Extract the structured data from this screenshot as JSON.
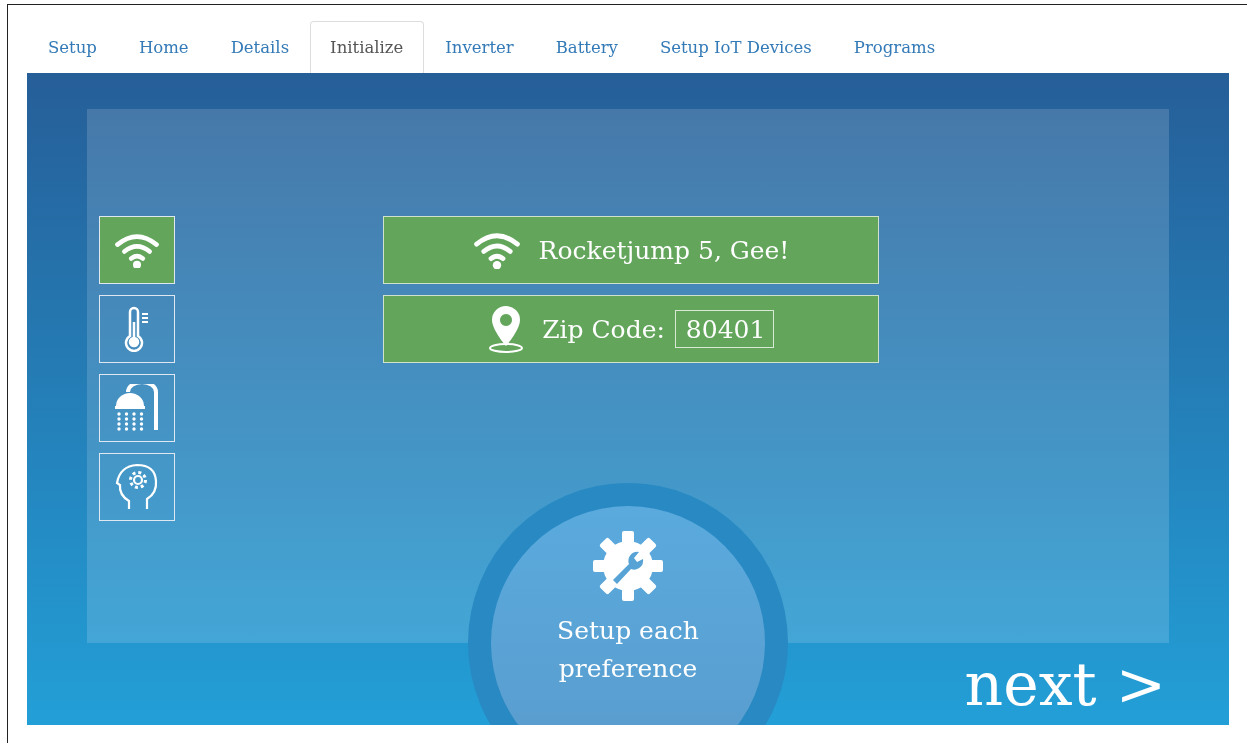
{
  "tabs": [
    {
      "label": "Setup",
      "selected": false
    },
    {
      "label": "Home",
      "selected": false
    },
    {
      "label": "Details",
      "selected": false
    },
    {
      "label": "Initialize",
      "selected": true
    },
    {
      "label": "Inverter",
      "selected": false
    },
    {
      "label": "Battery",
      "selected": false
    },
    {
      "label": "Setup IoT Devices",
      "selected": false
    },
    {
      "label": "Programs",
      "selected": false
    }
  ],
  "sidebar": {
    "items": [
      {
        "kind": "wifi",
        "selected": true
      },
      {
        "kind": "thermometer",
        "selected": false
      },
      {
        "kind": "shower",
        "selected": false
      },
      {
        "kind": "head",
        "selected": false
      }
    ]
  },
  "network": {
    "name": "Rocketjump 5, Gee!"
  },
  "location": {
    "label": "Zip Code:",
    "value": "80401"
  },
  "setup_circle": {
    "text": "Setup each preference"
  },
  "next_button": {
    "label": "next >"
  }
}
